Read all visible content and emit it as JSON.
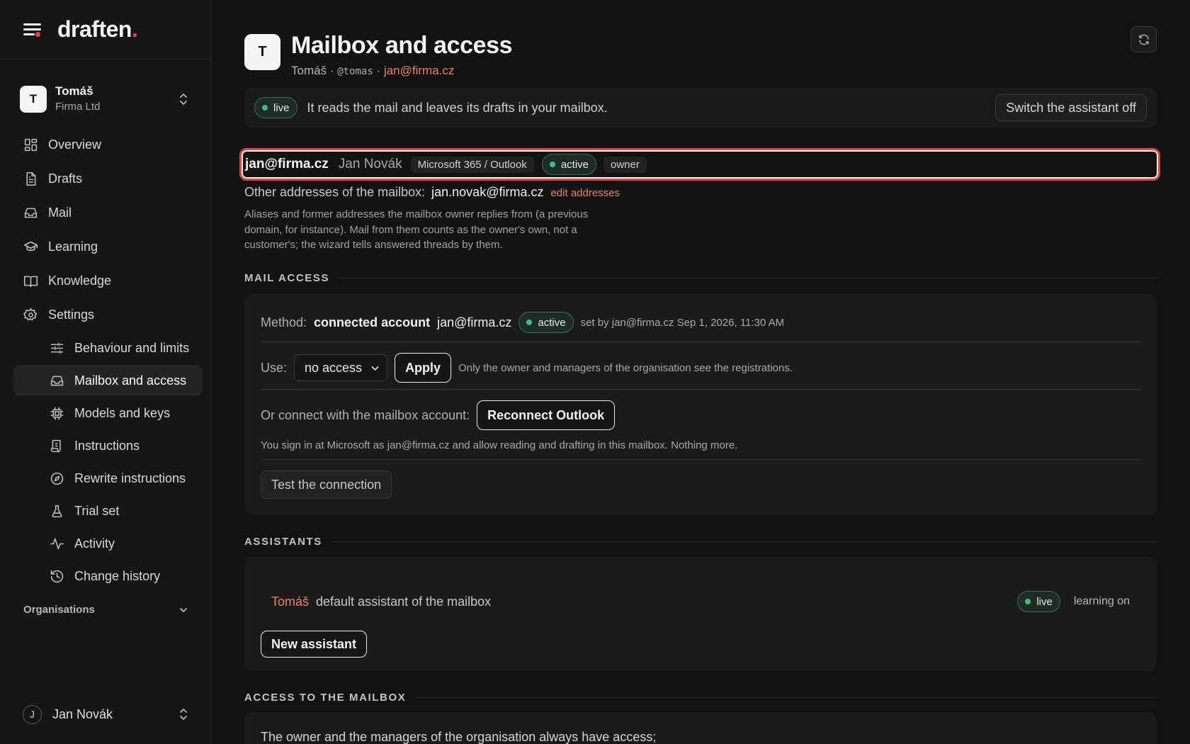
{
  "brand": {
    "name": "draften",
    "dot": "."
  },
  "profile": {
    "initial": "T",
    "name": "Tomáš",
    "org": "Firma Ltd"
  },
  "nav": {
    "overview": "Overview",
    "drafts": "Drafts",
    "mail": "Mail",
    "learning": "Learning",
    "knowledge": "Knowledge",
    "settings": "Settings",
    "behaviour": "Behaviour and limits",
    "mailbox": "Mailbox and access",
    "models": "Models and keys",
    "instructions": "Instructions",
    "rewrite": "Rewrite instructions",
    "trial": "Trial set",
    "activity": "Activity",
    "history": "Change history"
  },
  "organisations_label": "Organisations",
  "user": {
    "initial": "J",
    "name": "Jan Novák"
  },
  "header": {
    "initial": "T",
    "title": "Mailbox and access",
    "sub_name": "Tomáš",
    "sep": "·",
    "handle": "@tomas",
    "email": "jan@firma.cz"
  },
  "live_bar": {
    "status": "live",
    "text": "It reads the mail and leaves its drafts in your mailbox.",
    "switch_label": "Switch the assistant off"
  },
  "identity": {
    "email": "jan@firma.cz",
    "name": "Jan Novák",
    "provider": "Microsoft 365 / Outlook",
    "status": "active",
    "role": "owner"
  },
  "other_addresses": {
    "label": "Other addresses of the mailbox:",
    "value": "jan.novak@firma.cz",
    "edit_link": "edit addresses",
    "note": "Aliases and former addresses the mailbox owner replies from (a previous domain, for instance). Mail from them counts as the owner's own, not a customer's; the wizard tells answered threads by them."
  },
  "mail_access": {
    "section": "MAIL ACCESS",
    "method_label": "Method:",
    "method_value": "connected account",
    "method_email": "jan@firma.cz",
    "method_status": "active",
    "set_by": "set by jan@firma.cz Sep 1, 2026, 11:30 AM",
    "use_label": "Use:",
    "use_value": "no access",
    "apply_label": "Apply",
    "use_note": "Only the owner and managers of the organisation see the registrations.",
    "connect_label": "Or connect with the mailbox account:",
    "reconnect_label": "Reconnect Outlook",
    "connect_note": "You sign in at Microsoft as jan@firma.cz and allow reading and drafting in this mailbox. Nothing more.",
    "test_label": "Test the connection"
  },
  "assistants": {
    "section": "ASSISTANTS",
    "name": "Tomáš",
    "desc": "default assistant of the mailbox",
    "status": "live",
    "learning": "learning on",
    "new_label": "New assistant"
  },
  "access": {
    "section": "ACCESS TO THE MAILBOX",
    "text": "The owner and the managers of the organisation always have access;"
  }
}
